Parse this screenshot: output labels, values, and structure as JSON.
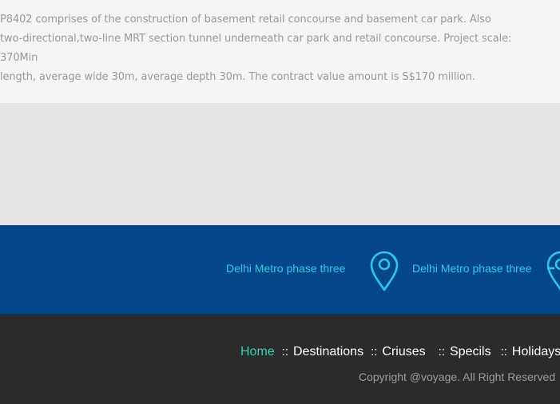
{
  "description": {
    "line1": "P8402 comprises of the construction of basement retail concourse and basement car park. Also",
    "line2": "two-directional,two-line MRT section tunnel underneath car park and retail concourse. Project scale: 370Min",
    "line3": "length, average wide 30m, average depth 30m. The contract value amount is S$170 million."
  },
  "ticker": {
    "items": [
      {
        "label": "Delhi Metro phase three",
        "icon": "map-pin-icon"
      },
      {
        "label": "Delhi Metro phase three",
        "icon": "map-pin-icon"
      }
    ],
    "color": "#29c9e4",
    "background": "#03478a"
  },
  "footer": {
    "nav": [
      {
        "label": "Home",
        "active": true
      },
      {
        "label": "Destinations",
        "active": false
      },
      {
        "label": "Criuses",
        "active": false
      },
      {
        "label": "Specils",
        "active": false
      },
      {
        "label": "Holidays",
        "active": false
      }
    ],
    "separator": "::",
    "copyright": "Copyright @voyage. All Right Reserved",
    "active_color": "#2fd0b3"
  }
}
